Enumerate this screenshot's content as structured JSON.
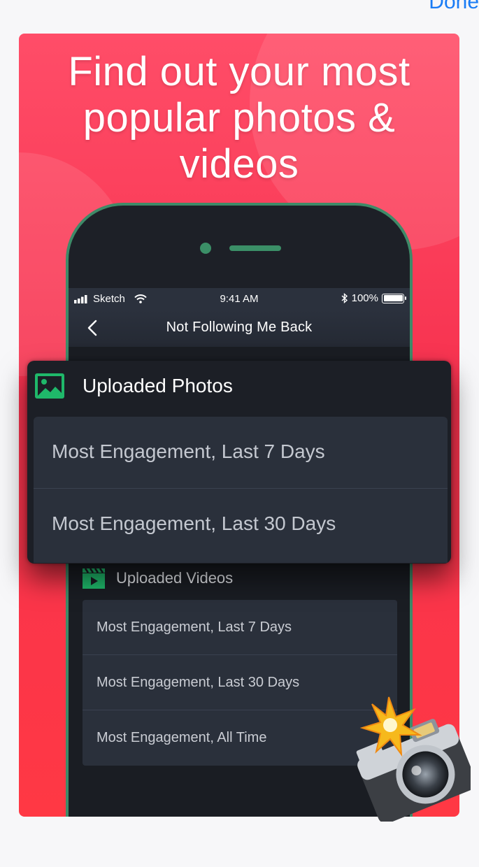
{
  "top_bar": {
    "done_label": "Done"
  },
  "promo": {
    "headline": "Find out your most popular photos & videos"
  },
  "status_bar": {
    "carrier": "Sketch",
    "time": "9:41 AM",
    "battery": "100%"
  },
  "nav": {
    "title": "Not Following Me Back"
  },
  "photos_section": {
    "title": "Uploaded Photos",
    "items": [
      {
        "label": "Most Engagement, Last 7 Days"
      },
      {
        "label": "Most Engagement, Last 30 Days"
      }
    ]
  },
  "videos_section": {
    "title": "Uploaded Videos",
    "items": [
      {
        "label": "Most Engagement, Last 7 Days"
      },
      {
        "label": "Most Engagement, Last 30 Days"
      },
      {
        "label": "Most Engagement, All Time"
      }
    ]
  },
  "colors": {
    "accent_green": "#1fb86a",
    "card_red": "#f7324f",
    "link_blue": "#1a7cf5"
  }
}
